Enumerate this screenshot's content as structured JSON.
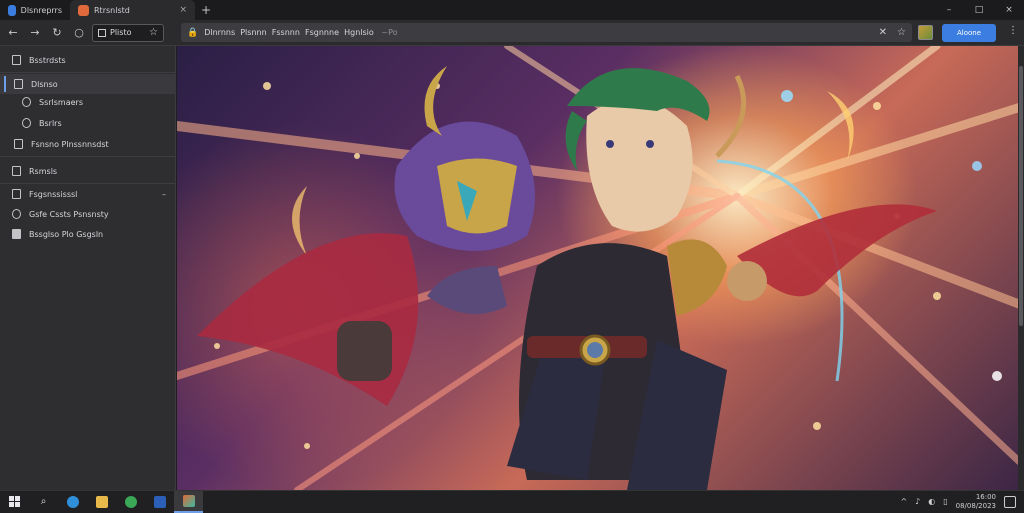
{
  "window": {
    "tabs": [
      {
        "label": "Dlsnreprrs",
        "icon": "browser-logo-icon",
        "active": false
      },
      {
        "label": "Rtrsnlstd",
        "icon": "site-favicon-icon",
        "active": true
      }
    ],
    "tab_close": "×",
    "new_tab": "+",
    "controls": {
      "minimize": "–",
      "maximize": "□",
      "close": "×"
    }
  },
  "toolbar": {
    "back": "←",
    "forward": "→",
    "reload": "↻",
    "home": "○",
    "mini_omnibox_text": "Plisto",
    "mini_star": "☆",
    "lock": "🔒",
    "url_parts": [
      "Dlnrnns",
      "Plsnnn",
      "Fssnnn",
      "Fsgnnne",
      "Hgnlsio"
    ],
    "url_suffix": "~Po",
    "clear": "✕",
    "star": "☆",
    "action_label": "Aloone",
    "menu": "⋮"
  },
  "sidebar": {
    "items": [
      {
        "label": "Bsstrdsts",
        "icon": "bookmark-icon",
        "selected": false
      },
      {
        "label": "Dlsnso",
        "icon": "folder-icon",
        "selected": true
      },
      {
        "label": "Ssrlsmaers",
        "icon": "history-icon",
        "selected": false
      },
      {
        "label": "Bsrlrs",
        "icon": "download-icon",
        "selected": false
      },
      {
        "label": "Fsnsno Plnssnnsdst",
        "icon": "settings-page-icon",
        "selected": false
      },
      {
        "label": "Rsmsls",
        "icon": "list-icon",
        "selected": false
      },
      {
        "label": "Fsgsnssisssl",
        "icon": "extension-icon",
        "selected": false
      },
      {
        "label": "Gsfe Cssts Psnsnsty",
        "icon": "shield-icon",
        "selected": false
      },
      {
        "label": "Bssglso Plo Gsgsln",
        "icon": "document-icon",
        "selected": false
      }
    ],
    "collapse_mark": "–"
  },
  "content": {
    "image_subject": "anime-warrior-artwork"
  },
  "taskbar": {
    "apps": [
      "windows-start-icon",
      "search-icon",
      "edge-icon",
      "file-explorer-icon",
      "chrome-icon",
      "word-icon",
      "paint-icon"
    ],
    "clock_time": "16:00",
    "clock_date": "08/08/2023",
    "tray_up": "^",
    "tray_symbols": [
      "♪",
      "◐",
      "▯"
    ]
  },
  "colors": {
    "accent": "#3b7de0",
    "sidebar_bg": "#2e2e31",
    "toolbar_bg": "#2b2b2e",
    "taskbar_bg": "#202022"
  }
}
